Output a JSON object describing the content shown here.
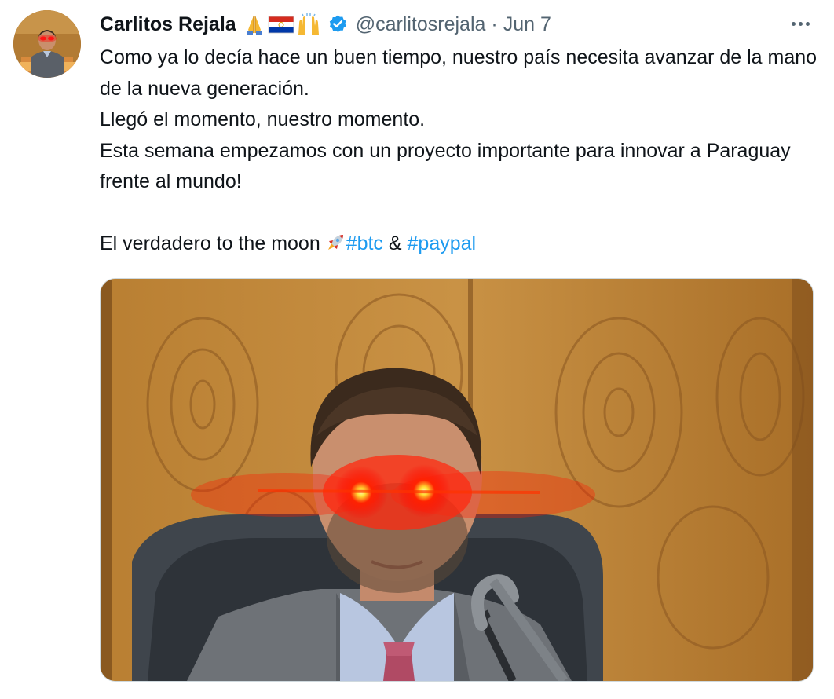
{
  "author": {
    "display_name": "Carlitos Rejala",
    "handle": "@carlitosrejala",
    "separator": "·",
    "date": "Jun 7",
    "emoji_icons": [
      "folded-hands-icon",
      "paraguay-flag-icon",
      "raising-hands-icon"
    ],
    "verified": true
  },
  "tweet": {
    "lines": [
      "Como ya lo decía hace un buen tiempo, nuestro país necesita avanzar de la mano de la nueva generación.",
      "Llegó el momento, nuestro momento.",
      "Esta semana empezamos con un proyecto importante para innovar a Paraguay frente al mundo!"
    ],
    "last_line_prefix": "El verdadero to the moon ",
    "hashtag_btc": "#btc",
    "ampersand": " & ",
    "hashtag_paypal": "#paypal"
  },
  "colors": {
    "link": "#1d9bf0",
    "secondary_text": "#536471",
    "verified_badge": "#1d9bf0"
  },
  "media": {
    "description_icon": "laser-eyes-photo"
  }
}
